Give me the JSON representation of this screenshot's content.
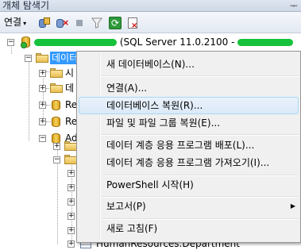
{
  "titlebar": {
    "title": "개체 탐색기",
    "pin_glyph": "ᅮ"
  },
  "toolbar": {
    "connect_label": "연결",
    "caret": "▾",
    "icons": [
      "connect-database-icon",
      "disconnect-icon",
      "stop-icon",
      "filter-icon",
      "refresh-icon",
      "summary-report-icon"
    ]
  },
  "tree": {
    "server": {
      "label_suffix": "(SQL Server 11.0.2100 -"
    },
    "databases_folder": {
      "label": "데이터베이스"
    },
    "children": [
      {
        "label": "시"
      },
      {
        "label": "데"
      },
      {
        "label": "Re"
      },
      {
        "label": "Re"
      },
      {
        "label": "Ad"
      }
    ],
    "table_row": {
      "label": "HumanResources.Department"
    }
  },
  "context_menu": {
    "items": [
      {
        "label": "새 데이터베이스(N)..."
      },
      {
        "label": "연결(A)..."
      },
      {
        "label": "데이터베이스 복원(R)..."
      },
      {
        "label": "파일 및 파일 그룹 복원(E)..."
      },
      {
        "label": "데이터 계층 응용 프로그램 배포(L)..."
      },
      {
        "label": "데이터 계층 응용 프로그램 가져오기(I)..."
      },
      {
        "label": "PowerShell 시작(H)"
      },
      {
        "label": "보고서(P)"
      },
      {
        "label": "새로 고침(F)"
      }
    ],
    "submenu_arrow": "▶"
  },
  "colors": {
    "selection": "#3399ff",
    "menu_highlight_border": "#a8d8f7",
    "masked_text": "#16c23a"
  }
}
